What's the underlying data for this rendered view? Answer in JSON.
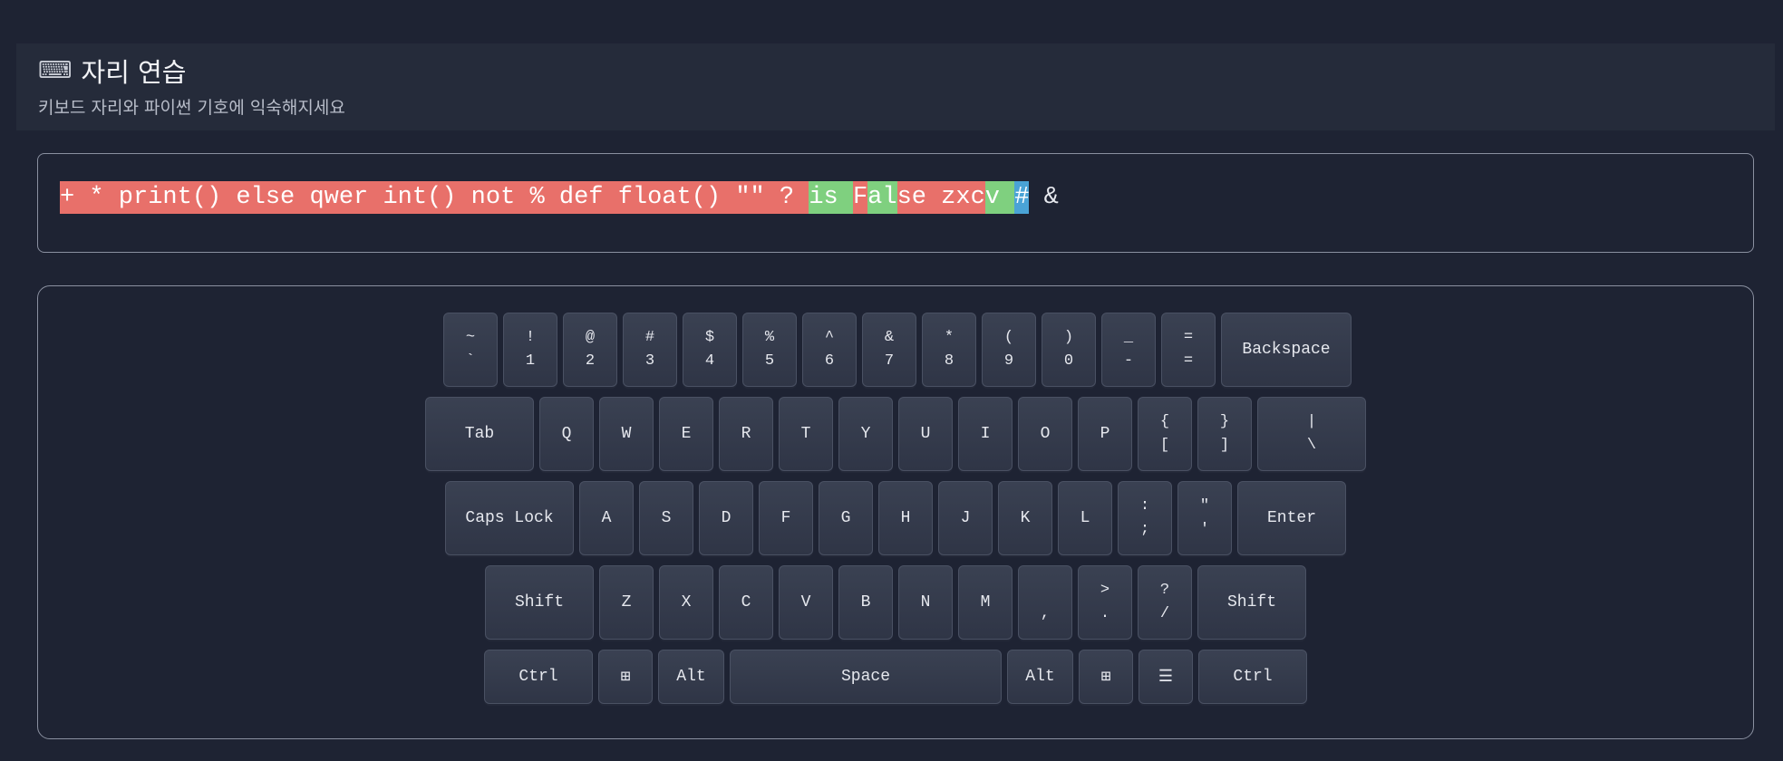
{
  "header": {
    "icon": "keyboard-icon",
    "icon_glyph": "⌨",
    "title": "자리 연습",
    "subtitle": "키보드 자리와 파이썬 기호에 익숙해지세요"
  },
  "practice": {
    "segments": [
      {
        "text": "+ * print() else qwer int() not % def float() \"\" ? ",
        "state": "wrong"
      },
      {
        "text": "is ",
        "state": "correct"
      },
      {
        "text": "F",
        "state": "wrong"
      },
      {
        "text": "al",
        "state": "correct"
      },
      {
        "text": "se zxc",
        "state": "wrong"
      },
      {
        "text": "v ",
        "state": "correct"
      },
      {
        "text": "#",
        "state": "current"
      },
      {
        "text": " &",
        "state": "pending"
      }
    ]
  },
  "keyboard": {
    "row1": [
      {
        "top": "~",
        "bottom": "`"
      },
      {
        "top": "!",
        "bottom": "1"
      },
      {
        "top": "@",
        "bottom": "2"
      },
      {
        "top": "#",
        "bottom": "3"
      },
      {
        "top": "$",
        "bottom": "4"
      },
      {
        "top": "%",
        "bottom": "5"
      },
      {
        "top": "^",
        "bottom": "6"
      },
      {
        "top": "&",
        "bottom": "7"
      },
      {
        "top": "*",
        "bottom": "8"
      },
      {
        "top": "(",
        "bottom": "9"
      },
      {
        "top": ")",
        "bottom": "0"
      },
      {
        "top": "_",
        "bottom": "-"
      },
      {
        "top": "=",
        "bottom": "="
      },
      {
        "label": "Backspace"
      }
    ],
    "row2": [
      {
        "label": "Tab"
      },
      {
        "label": "Q"
      },
      {
        "label": "W"
      },
      {
        "label": "E"
      },
      {
        "label": "R"
      },
      {
        "label": "T"
      },
      {
        "label": "Y"
      },
      {
        "label": "U"
      },
      {
        "label": "I"
      },
      {
        "label": "O"
      },
      {
        "label": "P"
      },
      {
        "top": "{",
        "bottom": "["
      },
      {
        "top": "}",
        "bottom": "]"
      },
      {
        "top": "|",
        "bottom": "\\"
      }
    ],
    "row3": [
      {
        "label": "Caps Lock"
      },
      {
        "label": "A"
      },
      {
        "label": "S"
      },
      {
        "label": "D"
      },
      {
        "label": "F"
      },
      {
        "label": "G"
      },
      {
        "label": "H"
      },
      {
        "label": "J"
      },
      {
        "label": "K"
      },
      {
        "label": "L"
      },
      {
        "top": ":",
        "bottom": ";"
      },
      {
        "top": "\"",
        "bottom": "'"
      },
      {
        "label": "Enter"
      }
    ],
    "row4": [
      {
        "label": "Shift"
      },
      {
        "label": "Z"
      },
      {
        "label": "X"
      },
      {
        "label": "C"
      },
      {
        "label": "V"
      },
      {
        "label": "B"
      },
      {
        "label": "N"
      },
      {
        "label": "M"
      },
      {
        "top": "",
        "bottom": ","
      },
      {
        "top": ">",
        "bottom": "."
      },
      {
        "top": "?",
        "bottom": "/"
      },
      {
        "label": "Shift"
      }
    ],
    "row5": [
      {
        "label": "Ctrl"
      },
      {
        "label": "⊞",
        "icon": "windows-icon"
      },
      {
        "label": "Alt"
      },
      {
        "label": "Space"
      },
      {
        "label": "Alt"
      },
      {
        "label": "⊞",
        "icon": "windows-icon"
      },
      {
        "label": "☰",
        "icon": "menu-icon"
      },
      {
        "label": "Ctrl"
      }
    ]
  },
  "colors": {
    "wrong": "#e8706a",
    "correct": "#7fd07f",
    "current": "#4aa3d6",
    "background": "#1e2333"
  }
}
